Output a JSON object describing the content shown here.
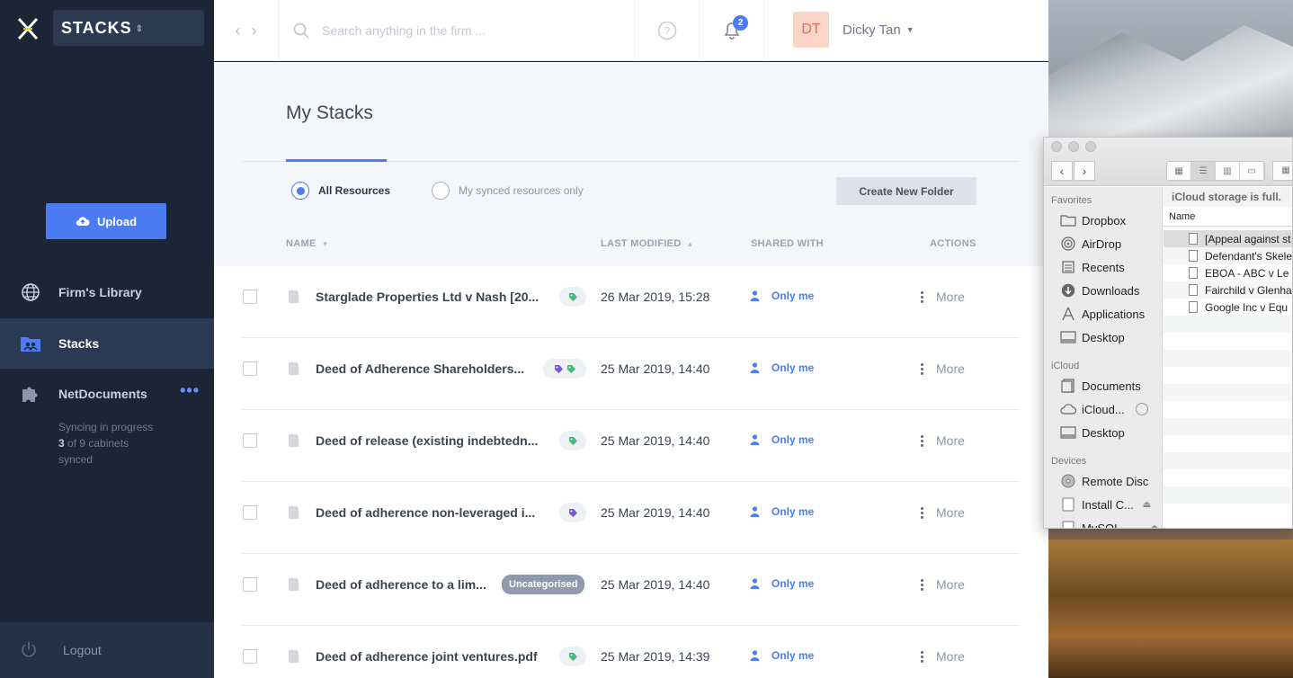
{
  "sidebar": {
    "brand": "STACKS",
    "upload_label": "Upload",
    "nav": [
      {
        "label": "Firm's Library",
        "icon": "globe-icon"
      },
      {
        "label": "Stacks",
        "icon": "folder-users-icon"
      },
      {
        "label": "NetDocuments",
        "icon": "puzzle-icon"
      }
    ],
    "sync": {
      "line1": "Syncing in progress",
      "count_done": "3",
      "count_rest": " of 9 cabinets",
      "line3": "synced"
    },
    "logout_label": "Logout"
  },
  "topbar": {
    "search_placeholder": "Search anything in the firm ...",
    "notifications_count": "2",
    "user_initials": "DT",
    "user_name": "Dicky Tan"
  },
  "main": {
    "title": "My Stacks",
    "filter": {
      "all": "All Resources",
      "synced": "My synced resources only"
    },
    "create_folder_label": "Create New Folder",
    "columns": {
      "name": "NAME",
      "modified": "LAST MODIFIED",
      "shared": "SHARED WITH",
      "actions": "ACTIONS"
    },
    "rows": [
      {
        "name": "Starglade Properties Ltd v Nash [20...",
        "tags": [
          "green"
        ],
        "modified": "26 Mar 2019, 15:28",
        "shared": "Only me",
        "action": "More"
      },
      {
        "name": "Deed of Adherence Shareholders...",
        "tags": [
          "purple",
          "green"
        ],
        "modified": "25 Mar 2019, 14:40",
        "shared": "Only me",
        "action": "More"
      },
      {
        "name": "Deed of release (existing indebtedn...",
        "tags": [
          "green"
        ],
        "modified": "25 Mar 2019, 14:40",
        "shared": "Only me",
        "action": "More"
      },
      {
        "name": "Deed of adherence non-leveraged i...",
        "tags": [
          "purple"
        ],
        "modified": "25 Mar 2019, 14:40",
        "shared": "Only me",
        "action": "More"
      },
      {
        "name": "Deed of adherence to a lim...",
        "tags": [],
        "label": "Uncategorised",
        "modified": "25 Mar 2019, 14:40",
        "shared": "Only me",
        "action": "More"
      },
      {
        "name": "Deed of adherence joint ventures.pdf",
        "tags": [
          "green"
        ],
        "modified": "25 Mar 2019, 14:39",
        "shared": "Only me",
        "action": "More"
      }
    ]
  },
  "finder": {
    "status_message": "iCloud storage is full.",
    "column_name": "Name",
    "sections": {
      "favorites": "Favorites",
      "icloud": "iCloud",
      "devices": "Devices"
    },
    "favorites": [
      "Dropbox",
      "AirDrop",
      "Recents",
      "Downloads",
      "Applications",
      "Desktop"
    ],
    "icloud": [
      "Documents",
      "iCloud...",
      "Desktop"
    ],
    "devices": [
      "Remote Disc",
      "Install C...",
      "MySQL..."
    ],
    "files": [
      "[Appeal against st",
      "Defendant's Skele",
      "EBOA  - ABC v Le",
      "Fairchild v Glenha",
      "Google Inc v Equ"
    ]
  },
  "colors": {
    "accent": "#4b7cf3",
    "sidebar_bg": "#1b2536",
    "tag_green": "#3dbf7a",
    "tag_purple": "#7b55d6",
    "avatar_bg": "#fbd5c8"
  }
}
